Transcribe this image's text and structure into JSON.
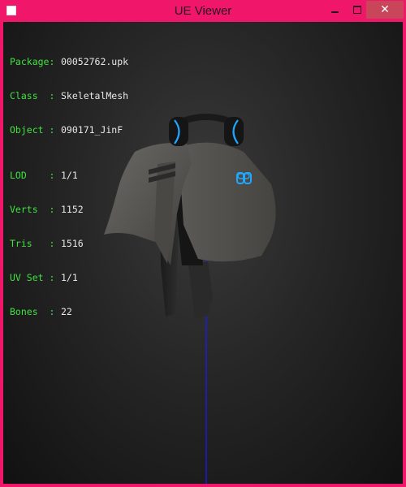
{
  "window": {
    "title": "UE Viewer",
    "close_glyph": "✕",
    "icons": {
      "app": "app-icon",
      "minimize": "minimize-icon",
      "maximize": "maximize-icon",
      "close": "close-icon"
    },
    "colors": {
      "frame": "#f0176b",
      "close_button": "#c8455a",
      "viewport_bg": "#262626"
    }
  },
  "info": {
    "package": {
      "label": "Package:",
      "value": "00052762.upk"
    },
    "class": {
      "label": "Class  :",
      "value": "SkeletalMesh"
    },
    "object": {
      "label": "Object :",
      "value": "090171_JinF"
    },
    "lod": {
      "label": "LOD    :",
      "value": "1/1"
    },
    "verts": {
      "label": "Verts  :",
      "value": "1152"
    },
    "tris": {
      "label": "Tris   :",
      "value": "1516"
    },
    "uvset": {
      "label": "UV Set :",
      "value": "1/1"
    },
    "bones": {
      "label": "Bones  :",
      "value": "22"
    },
    "colors": {
      "label": "#3fe23f",
      "value": "#e8e8e8"
    }
  },
  "scene": {
    "mesh_icon": "skeletal-mesh-model",
    "colors": {
      "mesh": "#5a5855",
      "accent": "#1ea8ff",
      "axis": "#1a1aff"
    }
  }
}
